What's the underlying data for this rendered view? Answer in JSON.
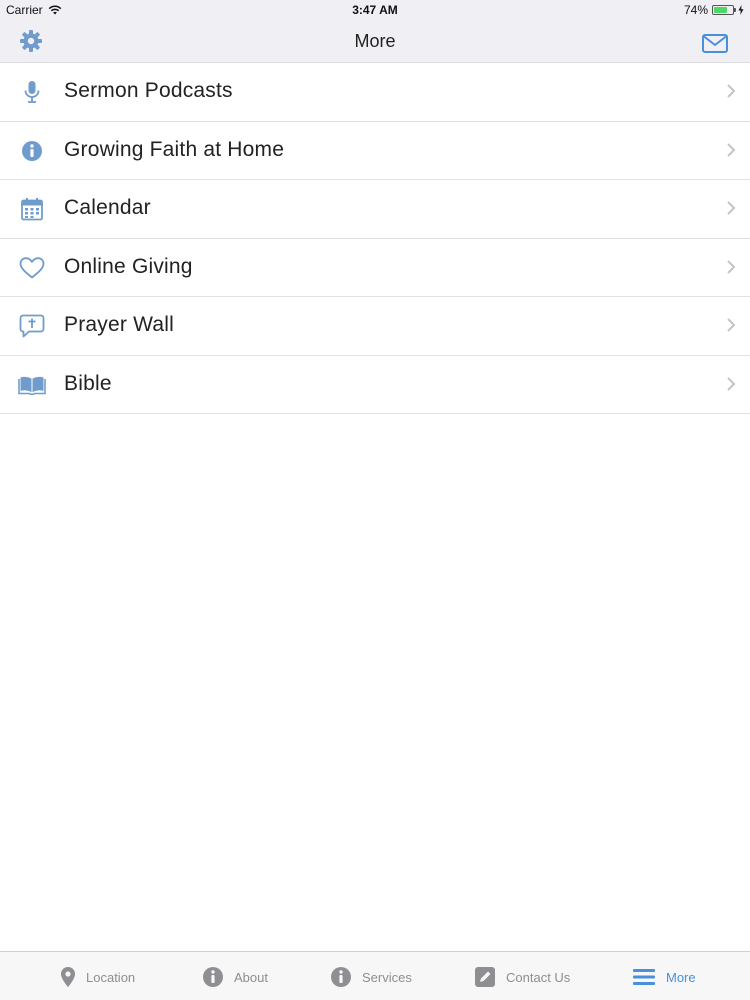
{
  "status_bar": {
    "carrier": "Carrier",
    "time": "3:47 AM",
    "battery_percent": "74%",
    "battery_level": 0.74
  },
  "nav": {
    "title": "More",
    "left_icon": "gear-icon",
    "right_icon": "mail-icon"
  },
  "menu": {
    "items": [
      {
        "label": "Sermon Podcasts",
        "icon": "microphone-icon"
      },
      {
        "label": "Growing Faith at Home",
        "icon": "info-icon"
      },
      {
        "label": "Calendar",
        "icon": "calendar-icon"
      },
      {
        "label": "Online Giving",
        "icon": "heart-icon"
      },
      {
        "label": "Prayer Wall",
        "icon": "speech-bubble-cross-icon"
      },
      {
        "label": "Bible",
        "icon": "open-book-icon"
      }
    ]
  },
  "tabbar": {
    "tabs": [
      {
        "label": "Location",
        "icon": "map-pin-icon",
        "active": false
      },
      {
        "label": "About",
        "icon": "info-icon",
        "active": false
      },
      {
        "label": "Services",
        "icon": "info-icon",
        "active": false
      },
      {
        "label": "Contact Us",
        "icon": "pencil-square-icon",
        "active": false
      },
      {
        "label": "More",
        "icon": "menu-lines-icon",
        "active": true
      }
    ]
  },
  "colors": {
    "accent": "#4a90d9",
    "icon_blue": "#6f9ccd",
    "inactive": "#8e8e93",
    "bar_background": "#efeff4"
  }
}
